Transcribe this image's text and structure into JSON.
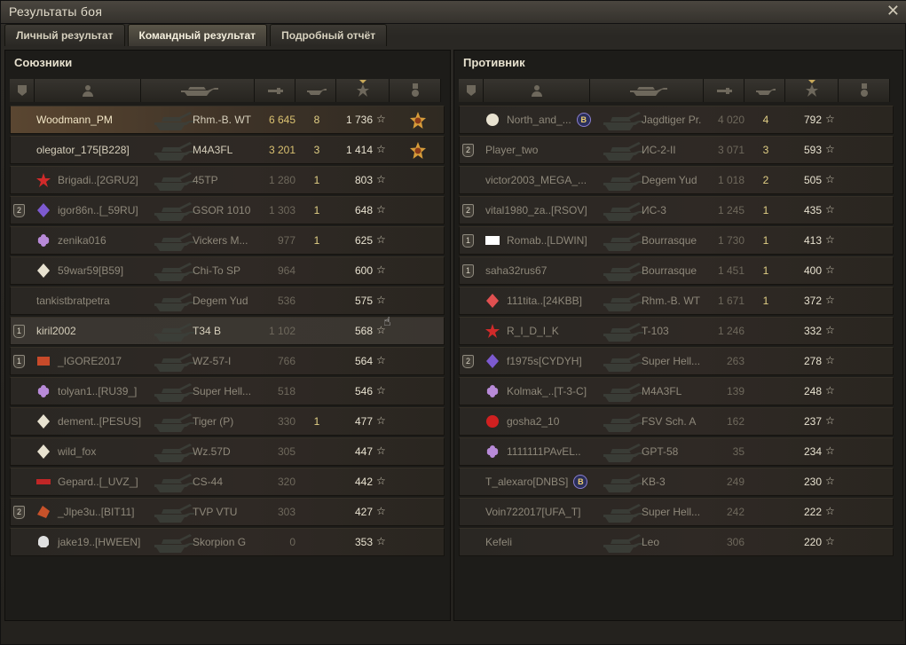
{
  "window": {
    "title": "Результаты боя"
  },
  "tabs": [
    {
      "label": "Личный результат"
    },
    {
      "label": "Командный результат"
    },
    {
      "label": "Подробный отчёт"
    }
  ],
  "allies": {
    "title": "Союзники",
    "rows": [
      {
        "platoon": "",
        "name": "Woodmann_PM",
        "vehicle": "Rhm.-B. WT",
        "damage": "6 645",
        "kills": "8",
        "xp": "1 736",
        "clan": "",
        "medal": true,
        "state": "me"
      },
      {
        "platoon": "",
        "name": "olegator_175[B228]",
        "vehicle": "M4A3FL",
        "damage": "3 201",
        "kills": "3",
        "xp": "1 414",
        "clan": "",
        "medal": true,
        "state": "live"
      },
      {
        "platoon": "",
        "name": "Brigadi..[2GRU2]",
        "vehicle": "45TP",
        "damage": "1 280",
        "kills": "1",
        "xp": "803",
        "clan": "red-star",
        "medal": false,
        "state": "dead"
      },
      {
        "platoon": "2",
        "name": "igor86n..[_59RU]",
        "vehicle": "GSOR 1010",
        "damage": "1 303",
        "kills": "1",
        "xp": "648",
        "clan": "purple",
        "medal": false,
        "state": "dead"
      },
      {
        "platoon": "",
        "name": "zenika016",
        "vehicle": "Vickers M...",
        "damage": "977",
        "kills": "1",
        "xp": "625",
        "clan": "flower",
        "medal": false,
        "state": "dead"
      },
      {
        "platoon": "",
        "name": "59war59[B59]",
        "vehicle": "Chi-To SP",
        "damage": "964",
        "kills": "",
        "xp": "600",
        "clan": "diamond",
        "medal": false,
        "state": "dead"
      },
      {
        "platoon": "",
        "name": "tankistbratpetra",
        "vehicle": "Degem Yud",
        "damage": "536",
        "kills": "",
        "xp": "575",
        "clan": "",
        "medal": false,
        "state": "dead"
      },
      {
        "platoon": "1",
        "name": "kiril2002",
        "vehicle": "T34 B",
        "damage": "1 102",
        "kills": "",
        "xp": "568",
        "clan": "",
        "medal": false,
        "state": "hl"
      },
      {
        "platoon": "1",
        "name": "_IGORE2017",
        "vehicle": "WZ-57-I",
        "damage": "766",
        "kills": "",
        "xp": "564",
        "clan": "keeper",
        "medal": false,
        "state": "dead"
      },
      {
        "platoon": "",
        "name": "tolyan1..[RU39_]",
        "vehicle": "Super Hell...",
        "damage": "518",
        "kills": "",
        "xp": "546",
        "clan": "flower",
        "medal": false,
        "state": "dead"
      },
      {
        "platoon": "",
        "name": "dement..[PESUS]",
        "vehicle": "Tiger (P)",
        "damage": "330",
        "kills": "1",
        "xp": "477",
        "clan": "diamond",
        "medal": false,
        "state": "dead"
      },
      {
        "platoon": "",
        "name": "wild_fox",
        "vehicle": "Wz.57D",
        "damage": "305",
        "kills": "",
        "xp": "447",
        "clan": "diamond",
        "medal": false,
        "state": "dead"
      },
      {
        "platoon": "",
        "name": "Gepard..[_UVZ_]",
        "vehicle": "CS-44",
        "damage": "320",
        "kills": "",
        "xp": "442",
        "clan": "mouth",
        "medal": false,
        "state": "dead"
      },
      {
        "platoon": "2",
        "name": "_Jlpe3u..[BIT11]",
        "vehicle": "TVP VTU",
        "damage": "303",
        "kills": "",
        "xp": "427",
        "clan": "dragon",
        "medal": false,
        "state": "dead"
      },
      {
        "platoon": "",
        "name": "jake19..[HWEEN]",
        "vehicle": "Skorpion G",
        "damage": "0",
        "kills": "",
        "xp": "353",
        "clan": "skull",
        "medal": false,
        "state": "dead"
      }
    ]
  },
  "enemies": {
    "title": "Противник",
    "rows": [
      {
        "platoon": "",
        "name": "North_and_...",
        "vehicle": "Jagdtiger Pr.",
        "damage": "4 020",
        "kills": "4",
        "xp": "792",
        "clan": "b-blue",
        "suffix_badge": true,
        "medal": false,
        "state": "dead"
      },
      {
        "platoon": "2",
        "name": "Player_two",
        "vehicle": "ИС-2-II",
        "damage": "3 071",
        "kills": "3",
        "xp": "593",
        "clan": "",
        "medal": false,
        "state": "dead"
      },
      {
        "platoon": "",
        "name": "victor2003_MEGA_...",
        "vehicle": "Degem Yud",
        "damage": "1 018",
        "kills": "2",
        "xp": "505",
        "clan": "",
        "medal": false,
        "state": "dead"
      },
      {
        "platoon": "2",
        "name": "vital1980_za..[RSOV]",
        "vehicle": "ИС-3",
        "damage": "1 245",
        "kills": "1",
        "xp": "435",
        "clan": "",
        "medal": false,
        "state": "dead"
      },
      {
        "platoon": "1",
        "name": "Romab..[LDWIN]",
        "vehicle": "Bourrasque",
        "damage": "1 730",
        "kills": "1",
        "xp": "413",
        "clan": "nerf",
        "medal": false,
        "state": "dead"
      },
      {
        "platoon": "1",
        "name": "saha32rus67",
        "vehicle": "Bourrasque",
        "damage": "1 451",
        "kills": "1",
        "xp": "400",
        "clan": "",
        "medal": false,
        "state": "dead"
      },
      {
        "platoon": "",
        "name": "111tita..[24KBB]",
        "vehicle": "Rhm.-B. WT",
        "damage": "1 671",
        "kills": "1",
        "xp": "372",
        "clan": "diamond-red",
        "medal": false,
        "state": "dead"
      },
      {
        "platoon": "",
        "name": "R_I_D_I_K",
        "vehicle": "T-103",
        "damage": "1 246",
        "kills": "",
        "xp": "332",
        "clan": "red-star",
        "medal": false,
        "state": "dead"
      },
      {
        "platoon": "2",
        "name": "f1975s[CYDYH]",
        "vehicle": "Super Hell...",
        "damage": "263",
        "kills": "",
        "xp": "278",
        "clan": "purple",
        "medal": false,
        "state": "dead"
      },
      {
        "platoon": "",
        "name": "Kolmak_..[T-3-C]",
        "vehicle": "M4A3FL",
        "damage": "139",
        "kills": "",
        "xp": "248",
        "clan": "flower",
        "medal": false,
        "state": "dead"
      },
      {
        "platoon": "",
        "name": "gosha2_10",
        "vehicle": "FSV Sch. A",
        "damage": "162",
        "kills": "",
        "xp": "237",
        "clan": "red-circle",
        "medal": false,
        "state": "dead"
      },
      {
        "platoon": "",
        "name": "1111111PAvEL..",
        "vehicle": "GPT-58",
        "damage": "35",
        "kills": "",
        "xp": "234",
        "clan": "flower",
        "medal": false,
        "state": "dead"
      },
      {
        "platoon": "",
        "name": "T_alexaro[DNBS]",
        "vehicle": "KB-3",
        "damage": "249",
        "kills": "",
        "xp": "230",
        "clan": "",
        "suffix_badge": true,
        "medal": false,
        "state": "dead"
      },
      {
        "platoon": "",
        "name": "Voin722017[UFA_T]",
        "vehicle": "Super Hell...",
        "damage": "242",
        "kills": "",
        "xp": "222",
        "clan": "",
        "medal": false,
        "state": "dead"
      },
      {
        "platoon": "",
        "name": "Kefeli",
        "vehicle": "Leo",
        "damage": "306",
        "kills": "",
        "xp": "220",
        "clan": "",
        "medal": false,
        "state": "dead"
      }
    ]
  },
  "colors": {
    "accent": "#c9a95a",
    "damage_alive": "#d9c070",
    "text": "#d6cfbb"
  },
  "icons": {
    "star": "star-icon",
    "platoon": "platoon-icon",
    "tank": "tank-icon",
    "medal": "medal-icon"
  }
}
